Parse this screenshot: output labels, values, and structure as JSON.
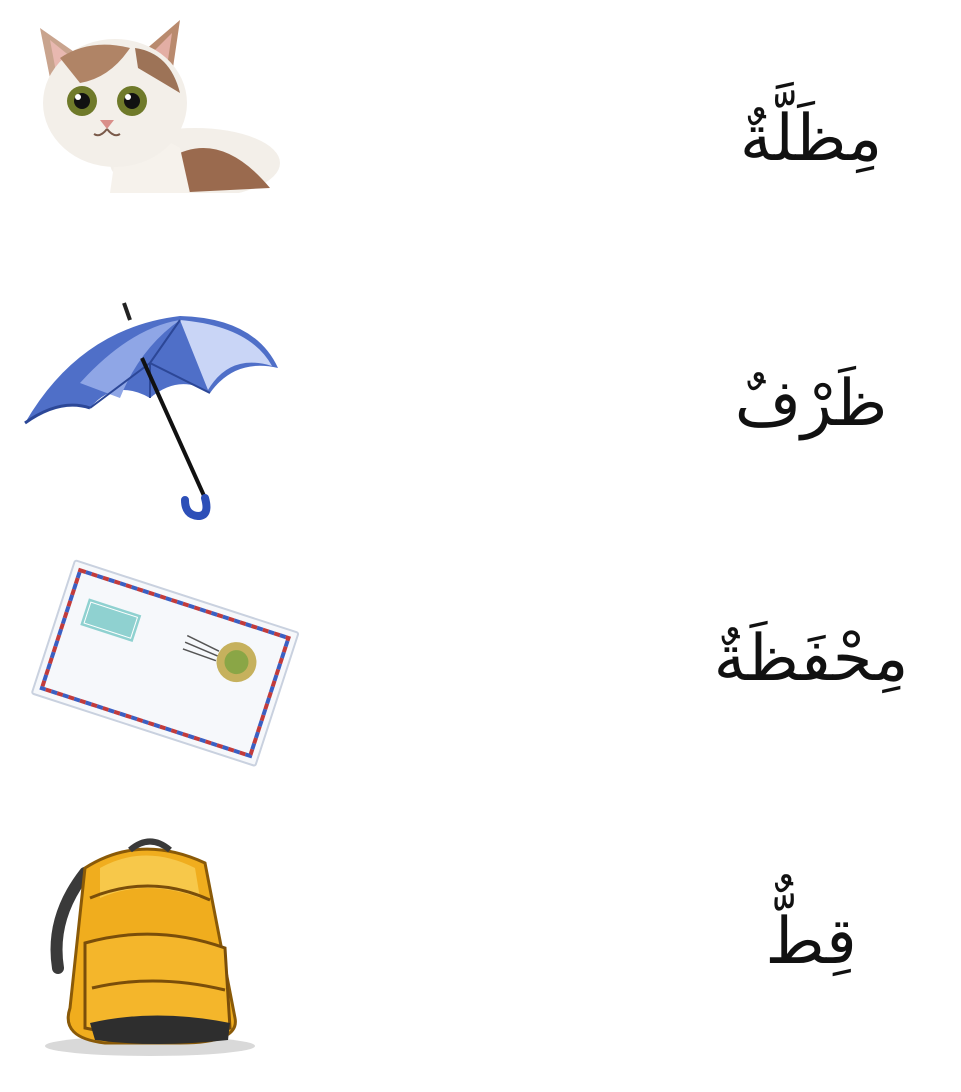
{
  "worksheet": {
    "items": [
      {
        "picture_icon": "kitten-icon",
        "word": "مِظَلَّةٌ"
      },
      {
        "picture_icon": "umbrella-icon",
        "word": "ظَرْفٌ"
      },
      {
        "picture_icon": "envelope-icon",
        "word": "مِحْفَظَةٌ"
      },
      {
        "picture_icon": "backpack-icon",
        "word": "قِطٌّ"
      }
    ]
  }
}
